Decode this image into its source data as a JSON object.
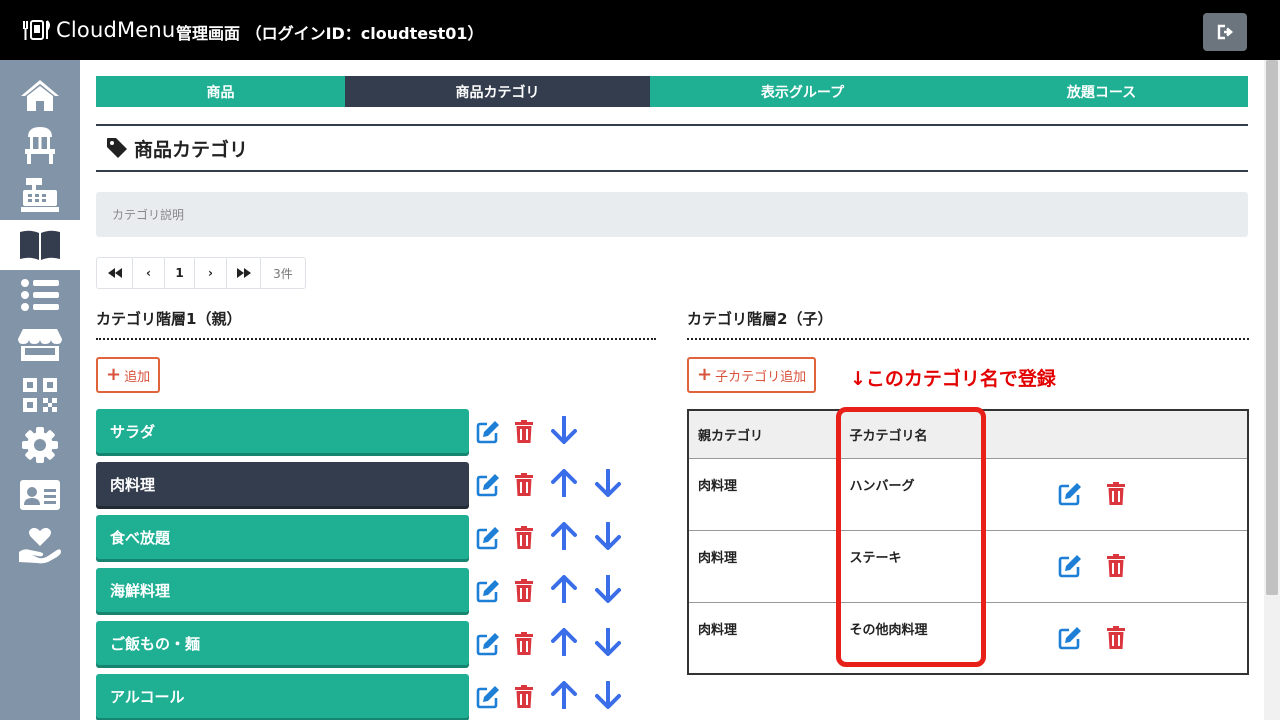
{
  "header": {
    "logo_text": "CloudMenu",
    "title": "管理画面 （ログインID：cloudtest01）"
  },
  "sidebar": {
    "items": [
      {
        "icon": "home-icon"
      },
      {
        "icon": "chair-icon"
      },
      {
        "icon": "cash-register-icon"
      },
      {
        "icon": "book-icon",
        "active": true
      },
      {
        "icon": "list-icon"
      },
      {
        "icon": "store-icon"
      },
      {
        "icon": "qr-code-icon"
      },
      {
        "icon": "gear-icon"
      },
      {
        "icon": "id-card-icon"
      },
      {
        "icon": "hand-heart-icon"
      }
    ]
  },
  "tabs": [
    {
      "label": "商品"
    },
    {
      "label": "商品カテゴリ",
      "active": true
    },
    {
      "label": "表示グループ"
    },
    {
      "label": "放題コース"
    }
  ],
  "page": {
    "title": "商品カテゴリ",
    "description": "カテゴリ説明"
  },
  "pagination": {
    "first": "⏪",
    "prev": "‹",
    "page": "1",
    "next": "›",
    "last": "⏩",
    "count": "3件"
  },
  "parent_section": {
    "heading": "カテゴリ階層1（親）",
    "add_label": "追加",
    "categories": [
      {
        "label": "サラダ",
        "active": false
      },
      {
        "label": "肉料理",
        "active": true
      },
      {
        "label": "食べ放題",
        "active": false
      },
      {
        "label": "海鮮料理",
        "active": false
      },
      {
        "label": "ご飯もの・麺",
        "active": false
      },
      {
        "label": "アルコール",
        "active": false
      }
    ]
  },
  "child_section": {
    "heading": "カテゴリ階層2（子）",
    "add_label": "子カテゴリ追加",
    "annotation": "↓このカテゴリ名で登録",
    "columns": [
      "親カテゴリ",
      "子カテゴリ名",
      ""
    ],
    "rows": [
      {
        "parent": "肉料理",
        "name": "ハンバーグ"
      },
      {
        "parent": "肉料理",
        "name": "ステーキ"
      },
      {
        "parent": "肉料理",
        "name": "その他肉料理"
      }
    ]
  },
  "colors": {
    "teal": "#1fb094",
    "navy": "#333d4e",
    "edit_blue": "#1e7fd6",
    "delete_red": "#d9363e",
    "arrow_blue": "#3a6ee8",
    "highlight_red": "#e8201a"
  }
}
